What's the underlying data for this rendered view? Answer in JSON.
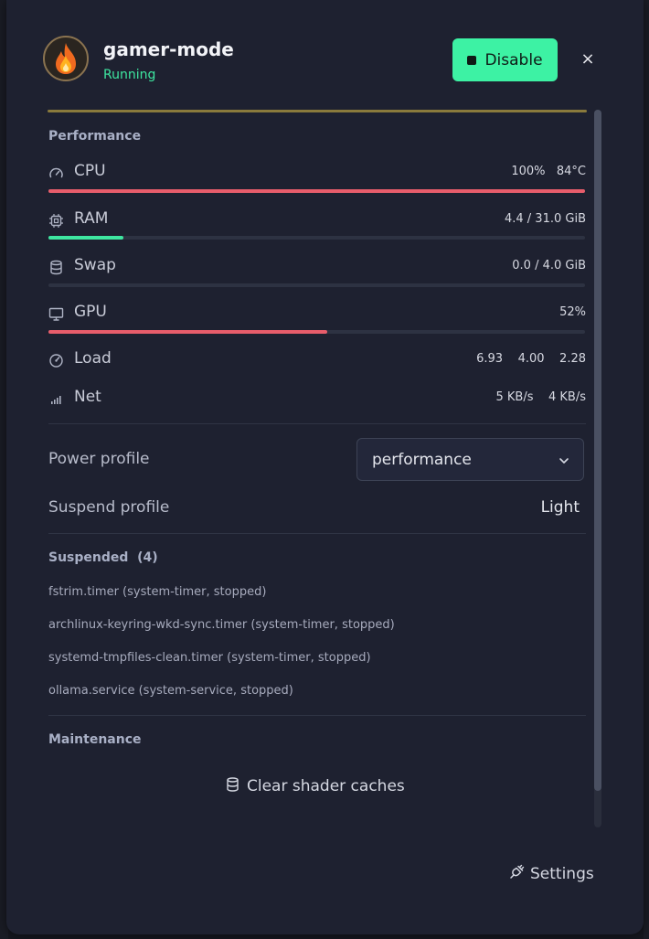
{
  "header": {
    "title": "gamer-mode",
    "status": "Running",
    "disable_label": "Disable",
    "close_glyph": "×",
    "app_icon": "flame-icon"
  },
  "performance": {
    "title": "Performance",
    "metrics": [
      {
        "label": "CPU",
        "value": "100%   84°C",
        "icon": "gauge-icon",
        "bar_fraction": 1.0,
        "bar_color": "#e85d6b"
      },
      {
        "label": "RAM",
        "value": "4.4 / 31.0 GiB",
        "icon": "chip-icon",
        "bar_fraction": 0.14,
        "bar_color": "#3ee6a0"
      },
      {
        "label": "Swap",
        "value": "0.0 / 4.0 GiB",
        "icon": "database-icon",
        "bar_fraction": 0.0,
        "bar_color": "#3ee6a0"
      },
      {
        "label": "GPU",
        "value": "52%",
        "icon": "monitor-icon",
        "bar_fraction": 0.52,
        "bar_color": "#e85d6b"
      },
      {
        "label": "Load",
        "value": "6.93    4.00    2.28",
        "icon": "speedometer-icon"
      },
      {
        "label": "Net",
        "value": "5 KB/s    4 KB/s",
        "icon": "signal-icon"
      }
    ]
  },
  "power": {
    "label": "Power profile",
    "selected": "performance"
  },
  "suspend": {
    "label": "Suspend profile",
    "value": "Light"
  },
  "suspended": {
    "title": "Suspended",
    "count": "(4)",
    "items": [
      "fstrim.timer (system-timer, stopped)",
      "archlinux-keyring-wkd-sync.timer (system-timer, stopped)",
      "systemd-tmpfiles-clean.timer (system-timer, stopped)",
      "ollama.service (system-service, stopped)"
    ]
  },
  "maintenance": {
    "title": "Maintenance",
    "clear_label": "Clear shader caches"
  },
  "footer": {
    "settings_label": "Settings"
  }
}
